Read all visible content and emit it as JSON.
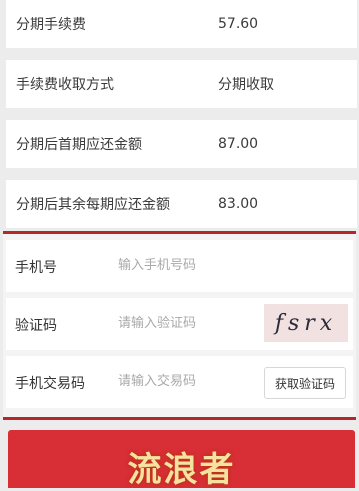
{
  "summary": [
    {
      "label": "分期手续费",
      "value": "57.60"
    },
    {
      "label": "手续费收取方式",
      "value": "分期收取"
    },
    {
      "label": "分期后首期应还金额",
      "value": "87.00"
    },
    {
      "label": "分期后其余每期应还金额",
      "value": "83.00"
    }
  ],
  "form": {
    "phone": {
      "label": "手机号",
      "placeholder": "输入手机号码"
    },
    "captcha": {
      "label": "验证码",
      "placeholder": "请输入验证码",
      "image_text": "fsrx"
    },
    "sms": {
      "label": "手机交易码",
      "placeholder": "请输入交易码",
      "button": "获取验证码"
    }
  },
  "submit": {
    "watermark": "流浪者"
  },
  "colors": {
    "accent": "#b3282b",
    "button": "#d82e36"
  }
}
